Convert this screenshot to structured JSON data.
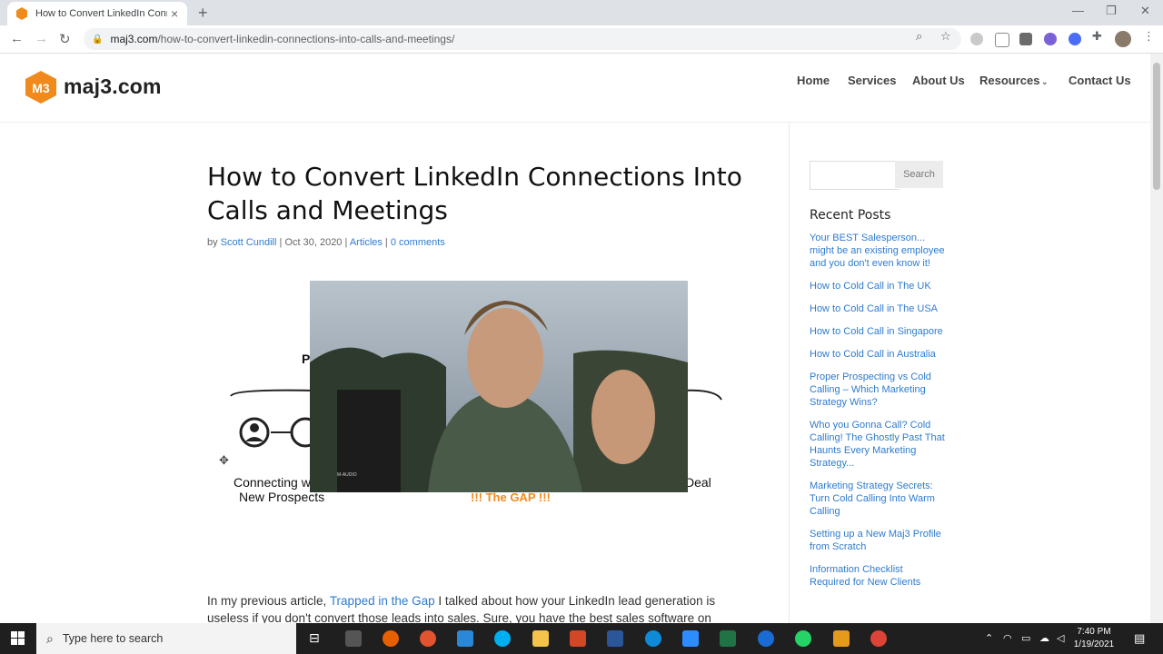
{
  "browser": {
    "tab_title": "How to Convert LinkedIn Conne",
    "new_tab": "+",
    "url_host": "maj3.com",
    "url_path": "/how-to-convert-linkedin-connections-into-calls-and-meetings/"
  },
  "site": {
    "logo_text": "maj3.com",
    "nav": [
      "Home",
      "Services",
      "About Us",
      "Resources",
      "Contact Us"
    ]
  },
  "post": {
    "title": "How to Convert LinkedIn Connections Into Calls and Meetings",
    "meta_by": "by",
    "author": "Scott Cundill",
    "date": "Oct 30, 2020",
    "category": "Articles",
    "comments": "0 comments",
    "figure_left_text": "Connecting w",
    "figure_left_text2": "New Prospects",
    "figure_right_text": "Deal",
    "figure_p_letter": "P",
    "figure_gap": "!!! The GAP !!!",
    "video_badge": "M-AUDIO",
    "intro_1": "In my previous article, ",
    "intro_link": "Trapped in the Gap",
    "intro_2": " I talked about how your LinkedIn lead generation is useless if you don't convert those leads into sales. Sure, you have the best sales software on"
  },
  "sidebar": {
    "search_placeholder": "",
    "search_button": "Search",
    "recent_heading": "Recent Posts",
    "recent_posts": [
      "Your BEST Salesperson... might be an existing employee and you don't even know it!",
      "How to Cold Call in The UK",
      "How to Cold Call in The USA",
      "How to Cold Call in Singapore",
      "How to Cold Call in Australia",
      "Proper Prospecting vs Cold Calling – Which Marketing Strategy Wins?",
      "Who you Gonna Call? Cold Calling! The Ghostly Past That Haunts Every Marketing Strategy...",
      "Marketing Strategy Secrets: Turn Cold Calling Into Warm Calling",
      "Setting up a New Maj3 Profile from Scratch",
      "Information Checklist Required for New Clients"
    ]
  },
  "taskbar": {
    "search_placeholder": "Type here to search",
    "time": "7:40 PM",
    "date": "1/19/2021"
  },
  "colors": {
    "link": "#2e7bcf",
    "logo_orange": "#f08a1c",
    "taskbar": "#1f1f1f"
  }
}
